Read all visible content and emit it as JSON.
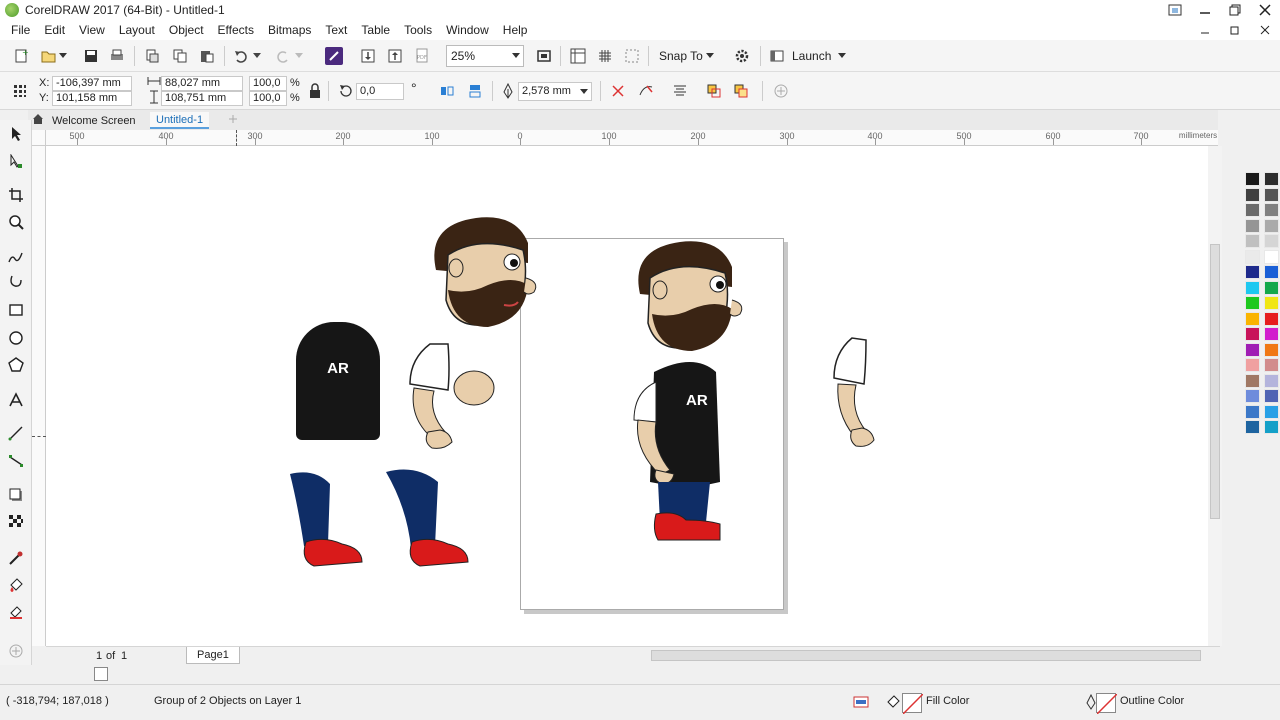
{
  "window": {
    "title": "CorelDRAW 2017 (64-Bit) - Untitled-1"
  },
  "menu": {
    "items": [
      "File",
      "Edit",
      "View",
      "Layout",
      "Object",
      "Effects",
      "Bitmaps",
      "Text",
      "Table",
      "Tools",
      "Window",
      "Help"
    ]
  },
  "standard_toolbar": {
    "zoom": "25%",
    "snap_to": "Snap To",
    "launch": "Launch"
  },
  "property_bar": {
    "x_label": "X:",
    "x_value": "-106,397 mm",
    "y_label": "Y:",
    "y_value": "101,158 mm",
    "width": "88,027 mm",
    "height": "108,751 mm",
    "scale_x": "100,0",
    "scale_y": "100,0",
    "percent": "%",
    "angle": "0,0",
    "degree": "°",
    "outline_width": "2,578 mm"
  },
  "doc_tabs": [
    "Welcome Screen",
    "Untitled-1"
  ],
  "ruler": {
    "unit": "millimeters",
    "labels": [
      "500",
      "400",
      "300",
      "200",
      "100",
      "0",
      "100",
      "200",
      "300",
      "400",
      "500",
      "600",
      "700"
    ]
  },
  "canvas": {
    "shirt_text_1": "AR",
    "shirt_text_2": "AR"
  },
  "page_nav": {
    "current": "1",
    "of_label": "of",
    "total": "1",
    "page_tab": "Page1"
  },
  "palette": {
    "colors": [
      "#1a1a1a",
      "#2d2d2d",
      "#404040",
      "#555555",
      "#6a6a6a",
      "#808080",
      "#959595",
      "#aaaaaa",
      "#c0c0c0",
      "#d5d5d5",
      "#eaeaea",
      "#ffffff",
      "#1e2a8c",
      "#1a5fd6",
      "#1ec8f0",
      "#14a84b",
      "#1ec81e",
      "#f0e614",
      "#fab400",
      "#e61e1e",
      "#c8145a",
      "#d21ecd",
      "#a01eb4",
      "#f07814",
      "#f0a0a0",
      "#d28c8c",
      "#a07864",
      "#b4b4dc",
      "#6e8cdc",
      "#5064b4",
      "#3c78c8",
      "#28a0e6",
      "#1e64a0",
      "#14a0c8"
    ]
  },
  "status": {
    "coords": "( -318,794; 187,018 )",
    "selection": "Group of 2 Objects on Layer 1",
    "fill_label": "Fill Color",
    "outline_label": "Outline Color"
  }
}
